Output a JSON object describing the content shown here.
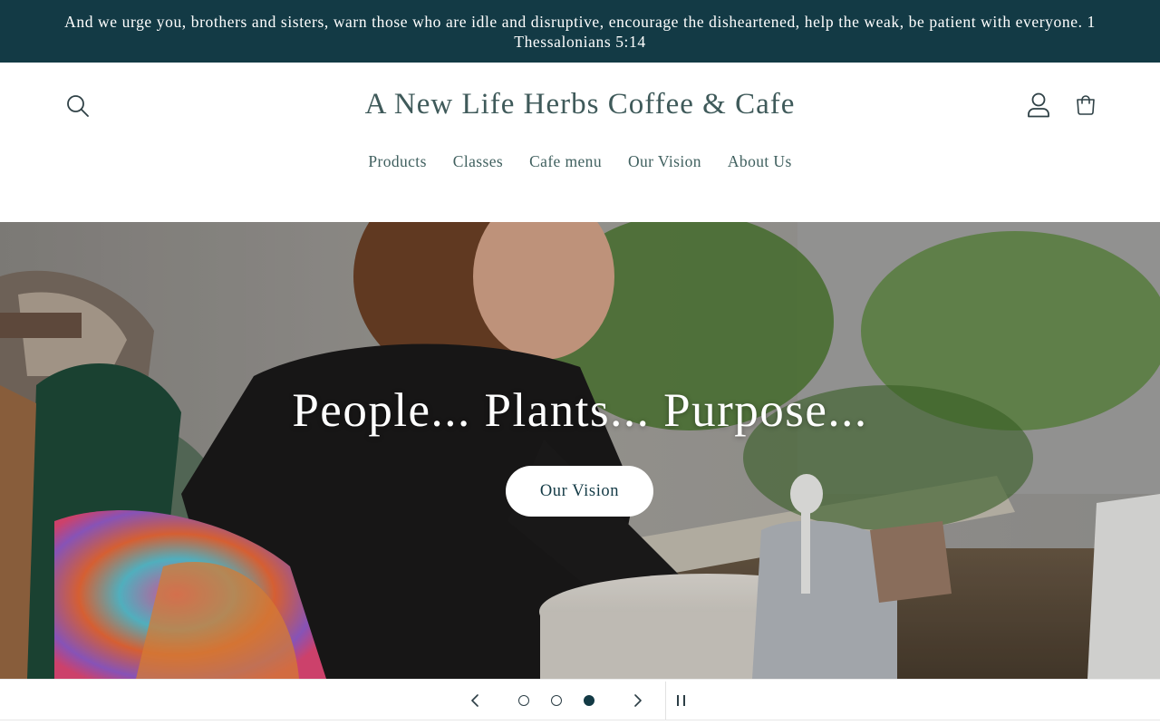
{
  "announcement": {
    "text": "And we urge you, brothers and sisters, warn those who are idle and disruptive, encourage the disheartened, help the weak, be patient with everyone. 1 Thessalonians 5:14"
  },
  "header": {
    "site_title": "A New Life Herbs Coffee & Cafe",
    "icons": {
      "search": "search-icon",
      "account": "account-icon",
      "cart": "cart-icon"
    }
  },
  "nav": {
    "items": [
      {
        "label": "Products"
      },
      {
        "label": "Classes"
      },
      {
        "label": "Cafe menu"
      },
      {
        "label": "Our Vision"
      },
      {
        "label": "About Us"
      }
    ]
  },
  "hero": {
    "heading": "People... Plants... Purpose...",
    "cta_label": "Our Vision"
  },
  "slider": {
    "slide_count": 3,
    "active_slide": 3,
    "icons": {
      "prev": "chevron-left-icon",
      "next": "chevron-right-icon",
      "pause": "pause-icon"
    }
  },
  "colors": {
    "announcement_bg": "#133a45",
    "title_text": "#3f5a5a",
    "nav_text": "#40605f",
    "button_bg": "#ffffff",
    "button_text": "#133a45",
    "active_dot": "#133a45"
  }
}
